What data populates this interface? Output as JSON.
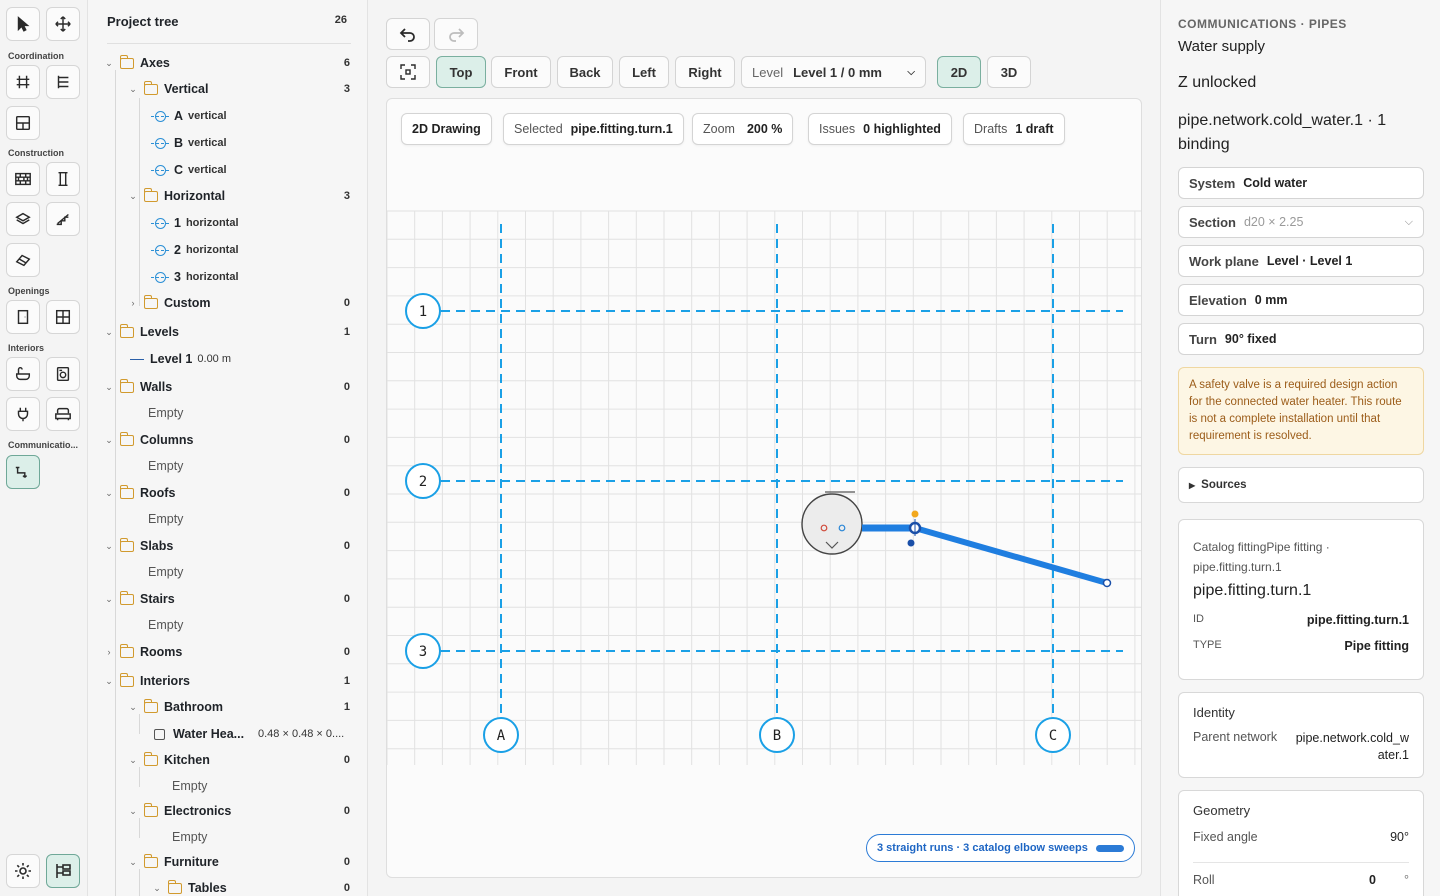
{
  "rail": {
    "sections": [
      "Coordination",
      "Construction",
      "Openings",
      "Interiors",
      "Communicatio..."
    ]
  },
  "tree": {
    "title": "Project tree",
    "total": "26",
    "rows": [
      {
        "kind": "folder",
        "name": "Axes",
        "count": "6",
        "open": true
      },
      {
        "kind": "folder",
        "name": "Vertical",
        "count": "3",
        "open": true
      },
      {
        "kind": "axis",
        "label": "A",
        "sub": "vertical"
      },
      {
        "kind": "axis",
        "label": "B",
        "sub": "vertical"
      },
      {
        "kind": "axis",
        "label": "C",
        "sub": "vertical"
      },
      {
        "kind": "folder",
        "name": "Horizontal",
        "count": "3",
        "open": true
      },
      {
        "kind": "axis",
        "label": "1",
        "sub": "horizontal"
      },
      {
        "kind": "axis",
        "label": "2",
        "sub": "horizontal"
      },
      {
        "kind": "axis",
        "label": "3",
        "sub": "horizontal"
      },
      {
        "kind": "folder",
        "name": "Custom",
        "count": "0",
        "open": false
      },
      {
        "kind": "folder",
        "name": "Levels",
        "count": "1",
        "open": true
      },
      {
        "kind": "level",
        "name": "Level 1",
        "sub": "0.00 m"
      },
      {
        "kind": "folder",
        "name": "Walls",
        "count": "0",
        "open": true
      },
      {
        "kind": "empty",
        "name": "Empty"
      },
      {
        "kind": "folder",
        "name": "Columns",
        "count": "0",
        "open": true
      },
      {
        "kind": "empty",
        "name": "Empty"
      },
      {
        "kind": "folder",
        "name": "Roofs",
        "count": "0",
        "open": true
      },
      {
        "kind": "empty",
        "name": "Empty"
      },
      {
        "kind": "folder",
        "name": "Slabs",
        "count": "0",
        "open": true
      },
      {
        "kind": "empty",
        "name": "Empty"
      },
      {
        "kind": "folder",
        "name": "Stairs",
        "count": "0",
        "open": true
      },
      {
        "kind": "empty",
        "name": "Empty"
      },
      {
        "kind": "folder",
        "name": "Rooms",
        "count": "0",
        "open": false
      },
      {
        "kind": "folder",
        "name": "Interiors",
        "count": "1",
        "open": true
      },
      {
        "kind": "folder",
        "name": "Bathroom",
        "count": "1",
        "open": true
      },
      {
        "kind": "item",
        "name": "Water Hea...",
        "sub": "0.48 × 0.48 × 0...."
      },
      {
        "kind": "folder",
        "name": "Kitchen",
        "count": "0",
        "open": true
      },
      {
        "kind": "empty",
        "name": "Empty"
      },
      {
        "kind": "folder",
        "name": "Electronics",
        "count": "0",
        "open": true
      },
      {
        "kind": "empty",
        "name": "Empty"
      },
      {
        "kind": "folder",
        "name": "Furniture",
        "count": "0",
        "open": true
      },
      {
        "kind": "folder",
        "name": "Tables",
        "count": "0",
        "open": true
      }
    ]
  },
  "toolbar": {
    "views": [
      "Top",
      "Front",
      "Back",
      "Left",
      "Right"
    ],
    "active_view": "Top",
    "level_key": "Level",
    "level_value": "Level 1 / 0 mm",
    "mode_2d": "2D",
    "mode_3d": "3D"
  },
  "canvas": {
    "chips": {
      "drawing": "2D Drawing",
      "selected_k": "Selected",
      "selected_v": "pipe.fitting.turn.1",
      "zoom_k": "Zoom",
      "zoom_v": "200 %",
      "issues_k": "Issues",
      "issues_v": "0 highlighted",
      "drafts_k": "Drafts",
      "drafts_v": "1 draft"
    },
    "axes_v": [
      "A",
      "B",
      "C"
    ],
    "axes_h": [
      "1",
      "2",
      "3"
    ],
    "status": "3 straight runs · 3 catalog elbow sweeps",
    "colors": {
      "axis": "#1aa0e6",
      "pipe": "#1f7ee0",
      "handle": "#f2a81d"
    }
  },
  "inspector": {
    "category": "COMMUNICATIONS · PIPES",
    "subtitle": "Water supply",
    "z": "Z unlocked",
    "identity": "pipe.network.cold_water.1 · 1 binding",
    "fields": {
      "system_k": "System",
      "system_v": "Cold water",
      "section_k": "Section",
      "section_v": "d20 × 2.25",
      "plane_k": "Work plane",
      "plane_v": "Level · Level 1",
      "elev_k": "Elevation",
      "elev_v": "0 mm",
      "turn_k": "Turn",
      "turn_v": "90° fixed"
    },
    "warning": "A safety valve is a required design action for the connected water heater. This route is not a complete installation until that requirement is resolved.",
    "sources": "Sources",
    "catalog": {
      "line1": "Catalog fittingPipe fitting ·",
      "line2": "pipe.fitting.turn.1",
      "title": "pipe.fitting.turn.1",
      "id_k": "ID",
      "id_v": "pipe.fitting.turn.1",
      "type_k": "TYPE",
      "type_v": "Pipe fitting"
    },
    "identity_card": {
      "title": "Identity",
      "parent_k": "Parent network",
      "parent_v": "pipe.network.cold_water.1"
    },
    "geometry": {
      "title": "Geometry",
      "angle_k": "Fixed angle",
      "angle_v": "90°",
      "roll_k": "Roll",
      "roll_v": "0",
      "roll_unit": "°"
    }
  }
}
